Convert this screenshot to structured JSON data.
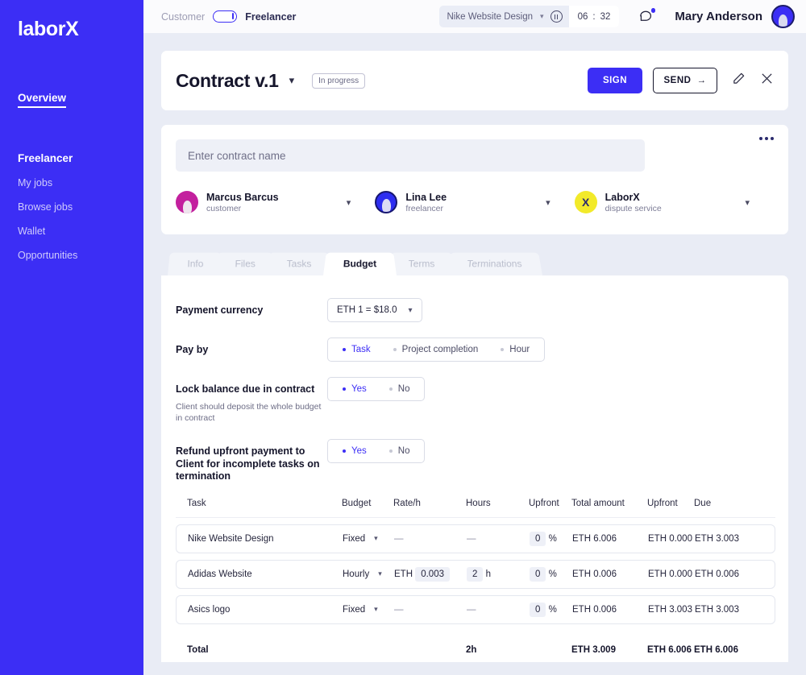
{
  "sidebar": {
    "logo": "laborX",
    "overview": "Overview",
    "group_title": "Freelancer",
    "items": [
      {
        "label": "My jobs"
      },
      {
        "label": "Browse jobs"
      },
      {
        "label": "Wallet"
      },
      {
        "label": "Opportunities"
      }
    ]
  },
  "topbar": {
    "role_customer": "Customer",
    "role_freelancer": "Freelancer",
    "project_name": "Nike Website Design",
    "timer_hours": "06",
    "timer_minutes": "32",
    "timer_separator": ":",
    "user_name": "Mary Anderson",
    "chat_icon": "chat-bubble-icon",
    "pause_icon": "pause-icon"
  },
  "contract_header": {
    "title": "Contract v.1",
    "status_badge": "In progress",
    "sign_label": "SIGN",
    "send_label": "SEND",
    "send_arrow": "→",
    "edit_icon": "pencil-icon",
    "close_icon": "close-icon"
  },
  "parties": {
    "name_placeholder": "Enter contract name",
    "name_value": "",
    "more_icon": "more-options-icon",
    "list": [
      {
        "name": "Marcus Barcus",
        "role": "customer",
        "avatar": "avatar-marcus",
        "color": "#c3209e"
      },
      {
        "name": "Lina Lee",
        "role": "freelancer",
        "avatar": "avatar-lina",
        "color": "#2d2df0"
      },
      {
        "name": "LaborX",
        "role": "dispute service",
        "avatar": "avatar-laborx",
        "color": "#f2ea2a",
        "initial": "X"
      }
    ]
  },
  "tabs": [
    {
      "label": "Info",
      "active": false
    },
    {
      "label": "Files",
      "active": false
    },
    {
      "label": "Tasks",
      "active": false
    },
    {
      "label": "Budget",
      "active": true
    },
    {
      "label": "Terms",
      "active": false
    },
    {
      "label": "Terminations",
      "active": false
    }
  ],
  "budget_form": {
    "payment_currency": {
      "label": "Payment currency",
      "value": "ETH 1 = $18.0"
    },
    "pay_by": {
      "label": "Pay by",
      "options": [
        {
          "label": "Task",
          "selected": true
        },
        {
          "label": "Project completion",
          "selected": false
        },
        {
          "label": "Hour",
          "selected": false
        }
      ]
    },
    "lock_balance": {
      "label": "Lock balance due in contract",
      "sub": "Client should deposit the whole budget in contract",
      "options": [
        {
          "label": "Yes",
          "selected": true
        },
        {
          "label": "No",
          "selected": false
        }
      ]
    },
    "refund_upfront": {
      "label": "Refund upfront payment to Client for incomplete tasks on termination",
      "options": [
        {
          "label": "Yes",
          "selected": true
        },
        {
          "label": "No",
          "selected": false
        }
      ]
    }
  },
  "table": {
    "headers": [
      "Task",
      "Budget",
      "Rate/h",
      "Hours",
      "Upfront",
      "Total amount",
      "Upfront",
      "Due"
    ],
    "rows": [
      {
        "task": "Nike Website Design",
        "budget_type": "Fixed",
        "rate_prefix": "",
        "rate": "—",
        "hours": "—",
        "hours_unit": "",
        "upfront_pct": "0",
        "pct_symbol": "%",
        "total_amount": "ETH 6.006",
        "upfront_amount": "ETH 0.000",
        "due": "ETH 3.003"
      },
      {
        "task": "Adidas Website",
        "budget_type": "Hourly",
        "rate_prefix": "ETH",
        "rate": "0.003",
        "hours": "2",
        "hours_unit": "h",
        "upfront_pct": "0",
        "pct_symbol": "%",
        "total_amount": "ETH 0.006",
        "upfront_amount": "ETH 0.000",
        "due": "ETH 0.006"
      },
      {
        "task": "Asics logo",
        "budget_type": "Fixed",
        "rate_prefix": "",
        "rate": "—",
        "hours": "—",
        "hours_unit": "",
        "upfront_pct": "0",
        "pct_symbol": "%",
        "total_amount": "ETH 0.006",
        "upfront_amount": "ETH 3.003",
        "due": "ETH 3.003"
      }
    ],
    "total": {
      "label": "Total",
      "hours": "2h",
      "total_amount": "ETH 3.009",
      "upfront_amount": "ETH 6.006",
      "due": "ETH 6.006"
    }
  },
  "colors": {
    "brand": "#3c2ef5",
    "page_bg": "#e9ecf5",
    "card_bg": "#ffffff",
    "accent_pink": "#c3209e",
    "accent_yellow": "#f2ea2a"
  }
}
